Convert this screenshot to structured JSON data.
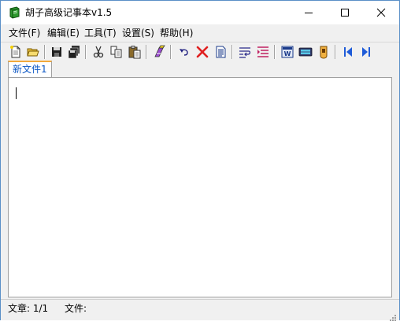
{
  "window": {
    "title": "胡子高级记事本v1.5",
    "controls": [
      "minimize",
      "maximize",
      "close"
    ]
  },
  "menu": [
    {
      "label": "文件(F)"
    },
    {
      "label": "编辑(E)"
    },
    {
      "label": "工具(T)"
    },
    {
      "label": "设置(S)"
    },
    {
      "label": "帮助(H)"
    }
  ],
  "toolbar": {
    "buttons": [
      "new-file",
      "open-folder",
      "save",
      "save-all",
      "cut",
      "copy",
      "paste",
      "format",
      "undo",
      "delete",
      "document",
      "word-wrap",
      "indent",
      "word",
      "keyboard",
      "palette",
      "first",
      "last"
    ]
  },
  "tabs": [
    {
      "label": "新文件1",
      "active": true
    }
  ],
  "editor": {
    "content": ""
  },
  "status": {
    "article": "文章: 1/1",
    "file": "文件:"
  },
  "colors": {
    "tab_text": "#0b56c4",
    "tab_accent": "#f2a93b",
    "close_icon": "#e02020",
    "nav_icon": "#1e5bd8"
  }
}
